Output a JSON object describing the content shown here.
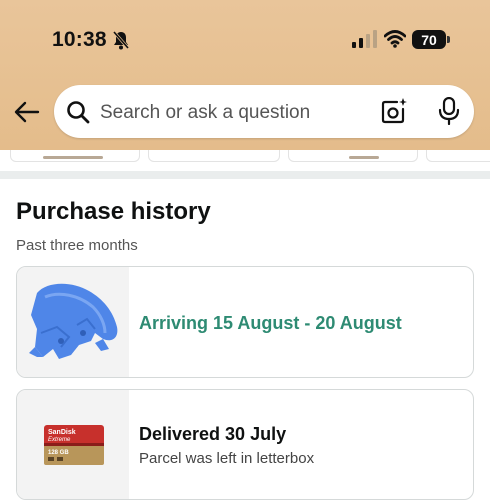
{
  "status_bar": {
    "time": "10:38",
    "battery": "70",
    "icons": [
      "bell-muted-icon",
      "cellular-signal-icon",
      "wifi-icon",
      "battery-icon"
    ]
  },
  "header": {
    "back_icon": "back-arrow-icon",
    "search": {
      "placeholder": "Search or ask a question",
      "icons": [
        "search-icon",
        "camera-icon",
        "microphone-icon"
      ]
    }
  },
  "purchase_history": {
    "title": "Purchase history",
    "subtitle": "Past three months",
    "orders": [
      {
        "status": "Arriving 15 August - 20 August",
        "detail": "",
        "image": "blue-plastic-part"
      },
      {
        "status": "Delivered 30 July",
        "detail": "Parcel was left in letterbox",
        "image": "sandisk-extreme-microsd-card"
      }
    ]
  },
  "product_thumbnails": {
    "sd_card": {
      "brand": "SanDisk",
      "line": "Extreme",
      "capacity": "128 GB"
    }
  },
  "colors": {
    "header_bg": "#e6c091",
    "arriving_green": "#2e8b73",
    "divider": "#eaeded",
    "card_border": "#d5d9d9"
  }
}
